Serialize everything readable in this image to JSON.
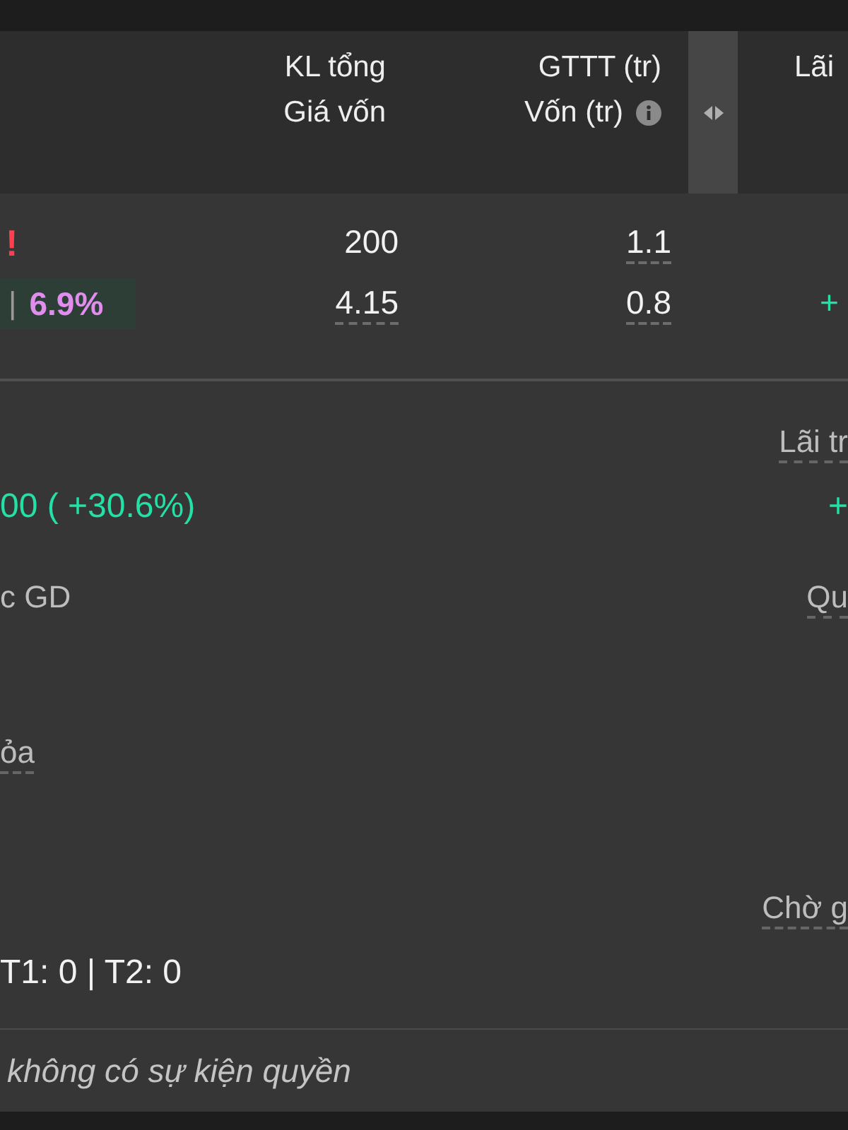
{
  "header": {
    "columns": [
      {
        "lines": [
          "KL tổng",
          "Giá vốn"
        ],
        "info": false
      },
      {
        "lines": [
          "GTTT (tr)",
          "Vốn (tr)"
        ],
        "info": true
      },
      {
        "lines": [
          "Lãi"
        ],
        "info": false
      }
    ]
  },
  "rows": [
    {
      "flag": "!",
      "kl": {
        "text": "200",
        "dotted": false
      },
      "gttt": {
        "text": "1.1",
        "dotted": true
      }
    },
    {
      "change": {
        "separator": "|",
        "text": "6.9%",
        "color": "#e08ded"
      },
      "kl": {
        "text": "4.15",
        "dotted": true
      },
      "gttt": {
        "text": "0.8",
        "dotted": true
      },
      "lai": {
        "text": "+",
        "color": "#22e0a6"
      }
    }
  ],
  "details": [
    {
      "left": {
        "value": {
          "text": "00 ( +30.6%)",
          "color": "#22e0a6"
        }
      },
      "right": {
        "label": {
          "text": "Lãi tr",
          "dotted": true
        },
        "value": {
          "text": "+",
          "color": "#22e0a6"
        }
      }
    },
    {
      "left": {
        "label": {
          "text": "c GD",
          "dotted": false
        }
      },
      "right": {
        "label": {
          "text": "Qu",
          "dotted": true
        }
      }
    },
    {
      "left": {
        "label": {
          "text": "ỏa",
          "dotted": true
        }
      }
    },
    {
      "left": {
        "value": {
          "text": "T1: 0 | T2: 0",
          "color": "#f2f2f2"
        }
      },
      "right": {
        "label": {
          "text": "Chờ g",
          "dotted": true
        }
      }
    }
  ],
  "note": "không có sự kiện quyền"
}
